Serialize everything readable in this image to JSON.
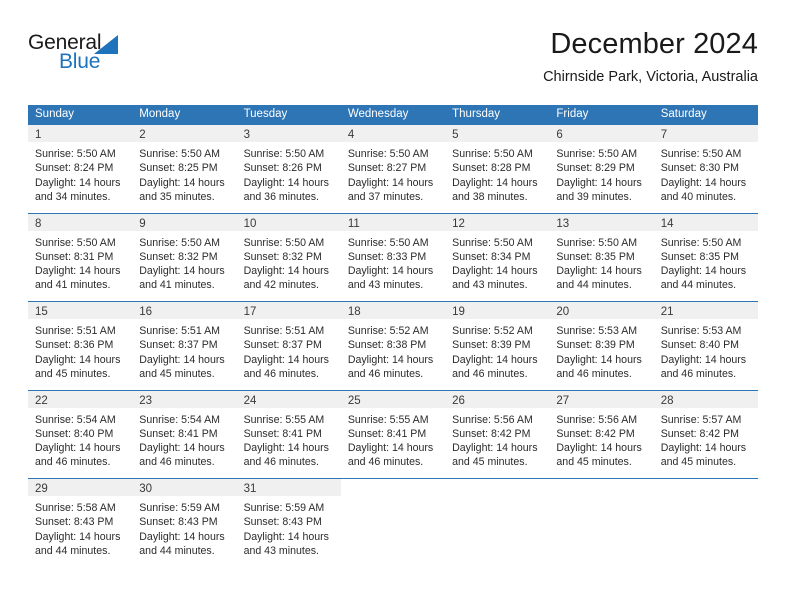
{
  "logo": {
    "word_one": "General",
    "word_two": "Blue",
    "triangle_icon": "triangle-icon",
    "brand_color": "#1f73bd"
  },
  "header": {
    "title": "December 2024",
    "subtitle": "Chirnside Park, Victoria, Australia"
  },
  "theme": {
    "header_bg": "#2e75b6",
    "day_band_bg": "#f0f0f0",
    "text": "#2b2b2b"
  },
  "weekdays": [
    "Sunday",
    "Monday",
    "Tuesday",
    "Wednesday",
    "Thursday",
    "Friday",
    "Saturday"
  ],
  "weeks": [
    [
      {
        "day": "1",
        "sunrise": "Sunrise: 5:50 AM",
        "sunset": "Sunset: 8:24 PM",
        "daylight_1": "Daylight: 14 hours",
        "daylight_2": "and 34 minutes."
      },
      {
        "day": "2",
        "sunrise": "Sunrise: 5:50 AM",
        "sunset": "Sunset: 8:25 PM",
        "daylight_1": "Daylight: 14 hours",
        "daylight_2": "and 35 minutes."
      },
      {
        "day": "3",
        "sunrise": "Sunrise: 5:50 AM",
        "sunset": "Sunset: 8:26 PM",
        "daylight_1": "Daylight: 14 hours",
        "daylight_2": "and 36 minutes."
      },
      {
        "day": "4",
        "sunrise": "Sunrise: 5:50 AM",
        "sunset": "Sunset: 8:27 PM",
        "daylight_1": "Daylight: 14 hours",
        "daylight_2": "and 37 minutes."
      },
      {
        "day": "5",
        "sunrise": "Sunrise: 5:50 AM",
        "sunset": "Sunset: 8:28 PM",
        "daylight_1": "Daylight: 14 hours",
        "daylight_2": "and 38 minutes."
      },
      {
        "day": "6",
        "sunrise": "Sunrise: 5:50 AM",
        "sunset": "Sunset: 8:29 PM",
        "daylight_1": "Daylight: 14 hours",
        "daylight_2": "and 39 minutes."
      },
      {
        "day": "7",
        "sunrise": "Sunrise: 5:50 AM",
        "sunset": "Sunset: 8:30 PM",
        "daylight_1": "Daylight: 14 hours",
        "daylight_2": "and 40 minutes."
      }
    ],
    [
      {
        "day": "8",
        "sunrise": "Sunrise: 5:50 AM",
        "sunset": "Sunset: 8:31 PM",
        "daylight_1": "Daylight: 14 hours",
        "daylight_2": "and 41 minutes."
      },
      {
        "day": "9",
        "sunrise": "Sunrise: 5:50 AM",
        "sunset": "Sunset: 8:32 PM",
        "daylight_1": "Daylight: 14 hours",
        "daylight_2": "and 41 minutes."
      },
      {
        "day": "10",
        "sunrise": "Sunrise: 5:50 AM",
        "sunset": "Sunset: 8:32 PM",
        "daylight_1": "Daylight: 14 hours",
        "daylight_2": "and 42 minutes."
      },
      {
        "day": "11",
        "sunrise": "Sunrise: 5:50 AM",
        "sunset": "Sunset: 8:33 PM",
        "daylight_1": "Daylight: 14 hours",
        "daylight_2": "and 43 minutes."
      },
      {
        "day": "12",
        "sunrise": "Sunrise: 5:50 AM",
        "sunset": "Sunset: 8:34 PM",
        "daylight_1": "Daylight: 14 hours",
        "daylight_2": "and 43 minutes."
      },
      {
        "day": "13",
        "sunrise": "Sunrise: 5:50 AM",
        "sunset": "Sunset: 8:35 PM",
        "daylight_1": "Daylight: 14 hours",
        "daylight_2": "and 44 minutes."
      },
      {
        "day": "14",
        "sunrise": "Sunrise: 5:50 AM",
        "sunset": "Sunset: 8:35 PM",
        "daylight_1": "Daylight: 14 hours",
        "daylight_2": "and 44 minutes."
      }
    ],
    [
      {
        "day": "15",
        "sunrise": "Sunrise: 5:51 AM",
        "sunset": "Sunset: 8:36 PM",
        "daylight_1": "Daylight: 14 hours",
        "daylight_2": "and 45 minutes."
      },
      {
        "day": "16",
        "sunrise": "Sunrise: 5:51 AM",
        "sunset": "Sunset: 8:37 PM",
        "daylight_1": "Daylight: 14 hours",
        "daylight_2": "and 45 minutes."
      },
      {
        "day": "17",
        "sunrise": "Sunrise: 5:51 AM",
        "sunset": "Sunset: 8:37 PM",
        "daylight_1": "Daylight: 14 hours",
        "daylight_2": "and 46 minutes."
      },
      {
        "day": "18",
        "sunrise": "Sunrise: 5:52 AM",
        "sunset": "Sunset: 8:38 PM",
        "daylight_1": "Daylight: 14 hours",
        "daylight_2": "and 46 minutes."
      },
      {
        "day": "19",
        "sunrise": "Sunrise: 5:52 AM",
        "sunset": "Sunset: 8:39 PM",
        "daylight_1": "Daylight: 14 hours",
        "daylight_2": "and 46 minutes."
      },
      {
        "day": "20",
        "sunrise": "Sunrise: 5:53 AM",
        "sunset": "Sunset: 8:39 PM",
        "daylight_1": "Daylight: 14 hours",
        "daylight_2": "and 46 minutes."
      },
      {
        "day": "21",
        "sunrise": "Sunrise: 5:53 AM",
        "sunset": "Sunset: 8:40 PM",
        "daylight_1": "Daylight: 14 hours",
        "daylight_2": "and 46 minutes."
      }
    ],
    [
      {
        "day": "22",
        "sunrise": "Sunrise: 5:54 AM",
        "sunset": "Sunset: 8:40 PM",
        "daylight_1": "Daylight: 14 hours",
        "daylight_2": "and 46 minutes."
      },
      {
        "day": "23",
        "sunrise": "Sunrise: 5:54 AM",
        "sunset": "Sunset: 8:41 PM",
        "daylight_1": "Daylight: 14 hours",
        "daylight_2": "and 46 minutes."
      },
      {
        "day": "24",
        "sunrise": "Sunrise: 5:55 AM",
        "sunset": "Sunset: 8:41 PM",
        "daylight_1": "Daylight: 14 hours",
        "daylight_2": "and 46 minutes."
      },
      {
        "day": "25",
        "sunrise": "Sunrise: 5:55 AM",
        "sunset": "Sunset: 8:41 PM",
        "daylight_1": "Daylight: 14 hours",
        "daylight_2": "and 46 minutes."
      },
      {
        "day": "26",
        "sunrise": "Sunrise: 5:56 AM",
        "sunset": "Sunset: 8:42 PM",
        "daylight_1": "Daylight: 14 hours",
        "daylight_2": "and 45 minutes."
      },
      {
        "day": "27",
        "sunrise": "Sunrise: 5:56 AM",
        "sunset": "Sunset: 8:42 PM",
        "daylight_1": "Daylight: 14 hours",
        "daylight_2": "and 45 minutes."
      },
      {
        "day": "28",
        "sunrise": "Sunrise: 5:57 AM",
        "sunset": "Sunset: 8:42 PM",
        "daylight_1": "Daylight: 14 hours",
        "daylight_2": "and 45 minutes."
      }
    ],
    [
      {
        "day": "29",
        "sunrise": "Sunrise: 5:58 AM",
        "sunset": "Sunset: 8:43 PM",
        "daylight_1": "Daylight: 14 hours",
        "daylight_2": "and 44 minutes."
      },
      {
        "day": "30",
        "sunrise": "Sunrise: 5:59 AM",
        "sunset": "Sunset: 8:43 PM",
        "daylight_1": "Daylight: 14 hours",
        "daylight_2": "and 44 minutes."
      },
      {
        "day": "31",
        "sunrise": "Sunrise: 5:59 AM",
        "sunset": "Sunset: 8:43 PM",
        "daylight_1": "Daylight: 14 hours",
        "daylight_2": "and 43 minutes."
      },
      {
        "day": "",
        "sunrise": "",
        "sunset": "",
        "daylight_1": "",
        "daylight_2": ""
      },
      {
        "day": "",
        "sunrise": "",
        "sunset": "",
        "daylight_1": "",
        "daylight_2": ""
      },
      {
        "day": "",
        "sunrise": "",
        "sunset": "",
        "daylight_1": "",
        "daylight_2": ""
      },
      {
        "day": "",
        "sunrise": "",
        "sunset": "",
        "daylight_1": "",
        "daylight_2": ""
      }
    ]
  ]
}
